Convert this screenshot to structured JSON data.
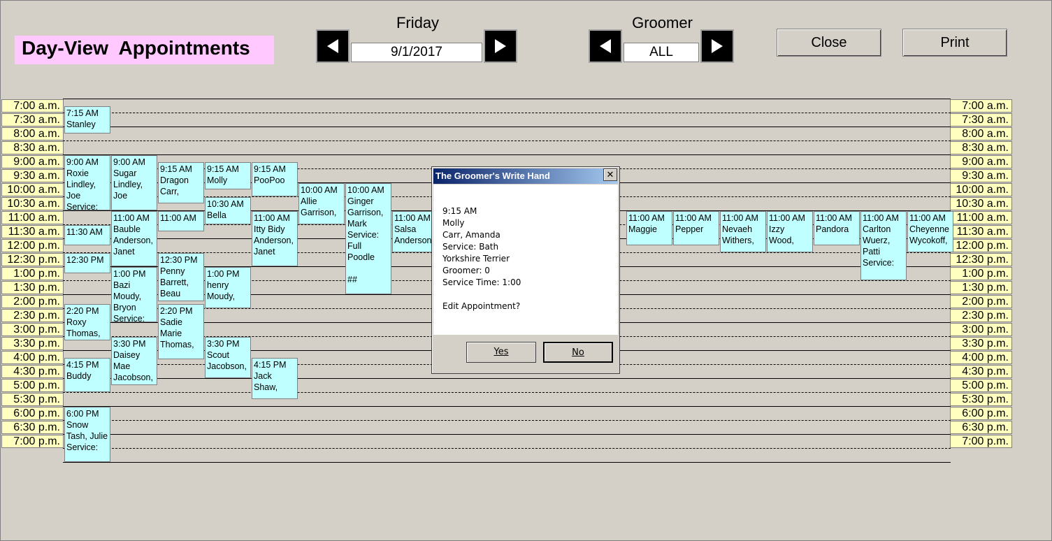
{
  "page_title": "Day-View  Appointments",
  "day": {
    "label": "Friday",
    "value": "9/1/2017"
  },
  "groomer": {
    "label": "Groomer",
    "value": "ALL"
  },
  "buttons": {
    "close": "Close",
    "print": "Print"
  },
  "time_slots": [
    "7:00 a.m.",
    "7:30 a.m.",
    "8:00 a.m.",
    "8:30 a.m.",
    "9:00 a.m.",
    "9:30 a.m.",
    "10:00 a.m.",
    "10:30 a.m.",
    "11:00 a.m.",
    "11:30 a.m.",
    "12:00 p.m.",
    "12:30 p.m.",
    "1:00 p.m.",
    "1:30 p.m.",
    "2:00 p.m.",
    "2:30 p.m.",
    "3:00 p.m.",
    "3:30 p.m.",
    "4:00 p.m.",
    "4:30 p.m.",
    "5:00 p.m.",
    "5:30 p.m.",
    "6:00 p.m.",
    "6:30 p.m.",
    "7:00 p.m."
  ],
  "appointments": [
    {
      "col": 0,
      "slot": 0.5,
      "span": 2,
      "text": "7:15 AM\nStanley"
    },
    {
      "col": 0,
      "slot": 4,
      "span": 4,
      "text": "9:00 AM\nRoxie\nLindley,\nJoe\nService:"
    },
    {
      "col": 0,
      "slot": 9,
      "span": 1.5,
      "text": "11:30 AM"
    },
    {
      "col": 0,
      "slot": 11,
      "span": 1.5,
      "text": "12:30 PM"
    },
    {
      "col": 0,
      "slot": 14.67,
      "span": 2.67,
      "text": "2:20 PM\nRoxy\nThomas,"
    },
    {
      "col": 0,
      "slot": 18.5,
      "span": 2.5,
      "text": "4:15 PM\nBuddy"
    },
    {
      "col": 0,
      "slot": 22,
      "span": 4,
      "text": "6:00 PM\nSnow\nTash, Julie\nService:"
    },
    {
      "col": 1,
      "slot": 4,
      "span": 4,
      "text": "9:00 AM\nSugar\nLindley,\nJoe"
    },
    {
      "col": 1,
      "slot": 8,
      "span": 4,
      "text": "11:00 AM\nBauble\nAnderson,\nJanet"
    },
    {
      "col": 1,
      "slot": 12,
      "span": 4,
      "text": "1:00 PM\nBazi\nMoudy,\nBryon\nService:"
    },
    {
      "col": 1,
      "slot": 17,
      "span": 3.5,
      "text": "3:30 PM\nDaisey\nMae\nJacobson,"
    },
    {
      "col": 2,
      "slot": 4.5,
      "span": 3,
      "text": "9:15 AM\nDragon\nCarr,"
    },
    {
      "col": 2,
      "slot": 8,
      "span": 1.5,
      "text": "11:00 AM"
    },
    {
      "col": 2,
      "slot": 11,
      "span": 3.5,
      "text": "12:30 PM\nPenny\nBarrett,\nBeau"
    },
    {
      "col": 2,
      "slot": 14.67,
      "span": 4,
      "text": "2:20 PM\nSadie\nMarie\nThomas,"
    },
    {
      "col": 3,
      "slot": 4.5,
      "span": 2,
      "text": "9:15 AM\nMolly"
    },
    {
      "col": 3,
      "slot": 7,
      "span": 2,
      "text": "10:30 AM\nBella"
    },
    {
      "col": 3,
      "slot": 12,
      "span": 3,
      "text": "1:00 PM\nhenry\nMoudy,"
    },
    {
      "col": 3,
      "slot": 17,
      "span": 3,
      "text": "3:30 PM\nScout\nJacobson,"
    },
    {
      "col": 4,
      "slot": 4.5,
      "span": 2.5,
      "text": "9:15 AM\nPooPoo"
    },
    {
      "col": 4,
      "slot": 8,
      "span": 4,
      "text": "11:00 AM\nItty Bidy\nAnderson,\nJanet"
    },
    {
      "col": 4,
      "slot": 18.5,
      "span": 3,
      "text": "4:15 PM\nJack\nShaw,"
    },
    {
      "col": 5,
      "slot": 6,
      "span": 3,
      "text": "10:00 AM\nAllie\nGarrison,"
    },
    {
      "col": 6,
      "slot": 6,
      "span": 8,
      "text": "10:00 AM\nGinger\nGarrison,\nMark\nService:\nFull\nPoodle\n\n##"
    },
    {
      "col": 7,
      "slot": 8,
      "span": 3,
      "text": "11:00 AM\nSalsa\nAnderson"
    },
    {
      "col": 12,
      "slot": 8,
      "span": 2.5,
      "text": "11:00 AM\nMaggie"
    },
    {
      "col": 13,
      "slot": 8,
      "span": 2.5,
      "text": "11:00 AM\nPepper"
    },
    {
      "col": 14,
      "slot": 8,
      "span": 3,
      "text": "11:00 AM\nNevaeh\nWithers,"
    },
    {
      "col": 15,
      "slot": 8,
      "span": 3,
      "text": "11:00 AM\nIzzy\nWood,"
    },
    {
      "col": 16,
      "slot": 8,
      "span": 2.5,
      "text": "11:00 AM\nPandora"
    },
    {
      "col": 17,
      "slot": 8,
      "span": 5,
      "text": "11:00 AM\nCarlton\nWuerz,\nPatti\nService:"
    },
    {
      "col": 18,
      "slot": 8,
      "span": 3,
      "text": "11:00 AM\nCheyenne\nWycokoff,"
    }
  ],
  "dialog": {
    "title": "The Groomer's Write Hand",
    "close_glyph": "✕",
    "lines": [
      "9:15 AM",
      "Molly",
      "Carr, Amanda",
      "Service: Bath",
      "Yorkshire Terrier",
      "Groomer: 0",
      "Service Time: 1:00",
      "",
      "Edit Appointment?"
    ],
    "yes": "Yes",
    "no": "No"
  }
}
